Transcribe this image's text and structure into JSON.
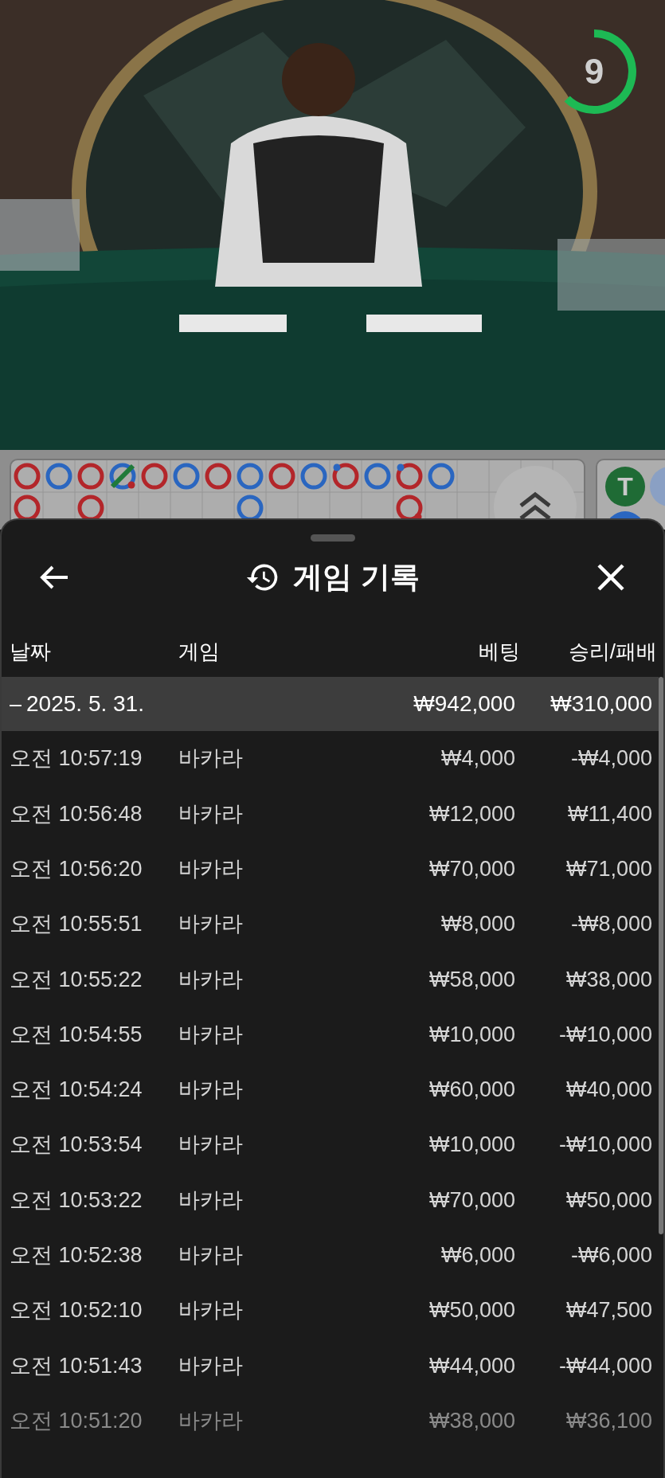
{
  "video": {
    "kind": "picture",
    "timer": {
      "text": "9"
    }
  },
  "bead_road": {
    "columns": [
      [
        {
          "color": "#b3262a",
          "tie": false,
          "player_pair": false,
          "banker_pair": false
        },
        {
          "color": "#b3262a",
          "tie": false,
          "player_pair": false,
          "banker_pair": false
        }
      ],
      [
        {
          "color": "#2a66c0",
          "tie": false,
          "player_pair": false,
          "banker_pair": false
        }
      ],
      [
        {
          "color": "#b3262a",
          "tie": false,
          "player_pair": false,
          "banker_pair": false
        },
        {
          "color": "#b3262a",
          "tie": false,
          "player_pair": false,
          "banker_pair": false
        }
      ],
      [
        {
          "color": "#2a66c0",
          "tie": true,
          "player_pair": false,
          "banker_pair": true
        }
      ],
      [
        {
          "color": "#b3262a",
          "tie": false,
          "player_pair": false,
          "banker_pair": false
        }
      ],
      [
        {
          "color": "#2a66c0",
          "tie": false,
          "player_pair": false,
          "banker_pair": false
        }
      ],
      [
        {
          "color": "#b3262a",
          "tie": false,
          "player_pair": false,
          "banker_pair": false
        }
      ],
      [
        {
          "color": "#2a66c0",
          "tie": false,
          "player_pair": false,
          "banker_pair": false
        },
        {
          "color": "#2a66c0",
          "tie": false,
          "player_pair": false,
          "banker_pair": false
        }
      ],
      [
        {
          "color": "#b3262a",
          "tie": false,
          "player_pair": false,
          "banker_pair": false
        }
      ],
      [
        {
          "color": "#2a66c0",
          "tie": false,
          "player_pair": false,
          "banker_pair": false
        }
      ],
      [
        {
          "color": "#b3262a",
          "tie": false,
          "player_pair": true,
          "banker_pair": false
        }
      ],
      [
        {
          "color": "#2a66c0",
          "tie": false,
          "player_pair": false,
          "banker_pair": false
        }
      ],
      [
        {
          "color": "#b3262a",
          "tie": false,
          "player_pair": true,
          "banker_pair": false
        },
        {
          "color": "#b3262a",
          "tie": false,
          "player_pair": false,
          "banker_pair": true
        }
      ],
      [
        {
          "color": "#2a66c0",
          "tie": false,
          "player_pair": false,
          "banker_pair": false
        }
      ]
    ],
    "side_badge": "T"
  },
  "sheet": {
    "title": "게임 기록",
    "columns": [
      "날짜",
      "게임",
      "베팅",
      "승리/패배"
    ],
    "summary": {
      "toggle": "–",
      "date": "2025. 5. 31.",
      "bet": "₩942,000",
      "result": "₩310,000"
    },
    "rows": [
      {
        "time": "오전 10:57:19",
        "game": "바카라",
        "bet": "₩4,000",
        "result": "-₩4,000"
      },
      {
        "time": "오전 10:56:48",
        "game": "바카라",
        "bet": "₩12,000",
        "result": "₩11,400"
      },
      {
        "time": "오전 10:56:20",
        "game": "바카라",
        "bet": "₩70,000",
        "result": "₩71,000"
      },
      {
        "time": "오전 10:55:51",
        "game": "바카라",
        "bet": "₩8,000",
        "result": "-₩8,000"
      },
      {
        "time": "오전 10:55:22",
        "game": "바카라",
        "bet": "₩58,000",
        "result": "₩38,000"
      },
      {
        "time": "오전 10:54:55",
        "game": "바카라",
        "bet": "₩10,000",
        "result": "-₩10,000"
      },
      {
        "time": "오전 10:54:24",
        "game": "바카라",
        "bet": "₩60,000",
        "result": "₩40,000"
      },
      {
        "time": "오전 10:53:54",
        "game": "바카라",
        "bet": "₩10,000",
        "result": "-₩10,000"
      },
      {
        "time": "오전 10:53:22",
        "game": "바카라",
        "bet": "₩70,000",
        "result": "₩50,000"
      },
      {
        "time": "오전 10:52:38",
        "game": "바카라",
        "bet": "₩6,000",
        "result": "-₩6,000"
      },
      {
        "time": "오전 10:52:10",
        "game": "바카라",
        "bet": "₩50,000",
        "result": "₩47,500"
      },
      {
        "time": "오전 10:51:43",
        "game": "바카라",
        "bet": "₩44,000",
        "result": "-₩44,000"
      },
      {
        "time": "오전 10:51:20",
        "game": "바카라",
        "bet": "₩38,000",
        "result": "₩36,100"
      }
    ]
  }
}
